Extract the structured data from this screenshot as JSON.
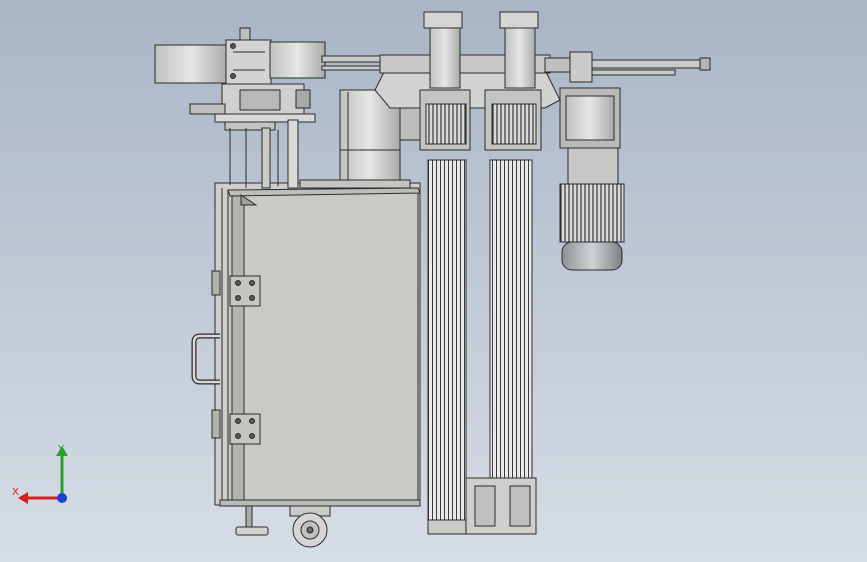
{
  "viewport": {
    "background_top": "#a9b5c6",
    "background_bottom": "#d7dde6",
    "model_line_color": "#2b2b2b",
    "model_fill_color": "#cfd1cf"
  },
  "triad": {
    "x_label": "X",
    "y_label": "Y",
    "x_color": "#d62020",
    "y_color": "#2aa02a",
    "z_color": "#1f3fd0"
  }
}
